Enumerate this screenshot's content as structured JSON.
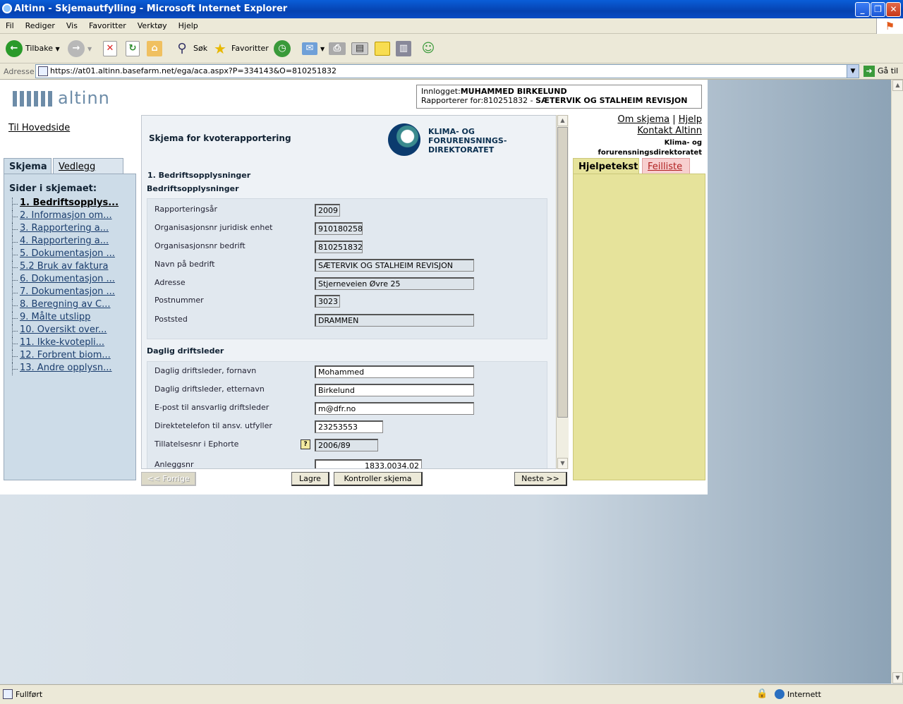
{
  "window": {
    "title": "Altinn - Skjemautfylling - Microsoft Internet Explorer"
  },
  "menu": [
    "Fil",
    "Rediger",
    "Vis",
    "Favoritter",
    "Verktøy",
    "Hjelp"
  ],
  "toolbar": {
    "back": "Tilbake",
    "search": "Søk",
    "favorites": "Favoritter"
  },
  "address": {
    "label": "Adresse",
    "url": "https://at01.altinn.basefarm.net/ega/aca.aspx?P=334143&O=810251832",
    "go": "Gå til"
  },
  "header": {
    "logo": "altinn",
    "login_label": "Innlogget:",
    "login_user": "MUHAMMED BIRKELUND",
    "reporter_label": "Rapporterer for:810251832 - ",
    "reporter_org": "SÆTERVIK OG STALHEIM REVISJON"
  },
  "left": {
    "home_link": "Til Hovedside",
    "tabs": [
      "Skjema",
      "Vedlegg"
    ],
    "pages_title": "Sider i skjemaet:",
    "pages": [
      "1. Bedriftsopplys...",
      "2. Informasjon om...",
      "3. Rapportering a...",
      "4. Rapportering a...",
      "5. Dokumentasjon ...",
      "5.2 Bruk av faktura",
      "6. Dokumentasjon ...",
      "7. Dokumentasjon ...",
      "8. Beregning av C...",
      "9. Målte utslipp",
      "10. Oversikt over...",
      "11. Ikke-kvotepli...",
      "12. Forbrent biom...",
      "13. Andre opplysn..."
    ]
  },
  "form": {
    "title": "Skjema for kvoterapportering",
    "agency_logo": [
      "KLIMA- OG",
      "FORURENSNINGS-",
      "DIREKTORATET"
    ],
    "section_number": "1. Bedriftsopplysninger",
    "section1_title": "Bedriftsopplysninger",
    "fields1": [
      {
        "label": "Rapporteringsår",
        "value": "2009"
      },
      {
        "label": "Organisasjonsnr juridisk enhet",
        "value": "910180258"
      },
      {
        "label": "Organisasjonsnr bedrift",
        "value": "810251832"
      },
      {
        "label": "Navn på bedrift",
        "value": "SÆTERVIK OG STALHEIM REVISJON"
      },
      {
        "label": "Adresse",
        "value": "Stjerneveien Øvre 25"
      },
      {
        "label": "Postnummer",
        "value": "3023"
      },
      {
        "label": "Poststed",
        "value": "DRAMMEN"
      }
    ],
    "section2_title": "Daglig driftsleder",
    "fields2": [
      {
        "label": "Daglig driftsleder, fornavn",
        "value": "Mohammed"
      },
      {
        "label": "Daglig driftsleder, etternavn",
        "value": "Birkelund"
      },
      {
        "label": "E-post til ansvarlig driftsleder",
        "value": "m@dfr.no"
      },
      {
        "label": "Direktetelefon til ansv. utfyller",
        "value": "23253553"
      },
      {
        "label": "Tillatelsesnr i Ephorte",
        "value": "2006/89"
      },
      {
        "label": "Anleggsnr",
        "value": "1833.0034.02"
      }
    ],
    "help_glyph": "?",
    "buttons": {
      "prev": "<< Forrige",
      "save": "Lagre",
      "check": "Kontroller skjema",
      "next": "Neste >>"
    }
  },
  "right": {
    "links": [
      "Om skjema",
      "Hjelp",
      "Kontakt Altinn"
    ],
    "separator": "|",
    "agency": [
      "Klima- og",
      "forurensningsdirektoratet"
    ],
    "tabs": [
      "Hjelpetekst",
      "Feilliste"
    ]
  },
  "status": {
    "text": "Fullført",
    "zone": "Internett"
  }
}
